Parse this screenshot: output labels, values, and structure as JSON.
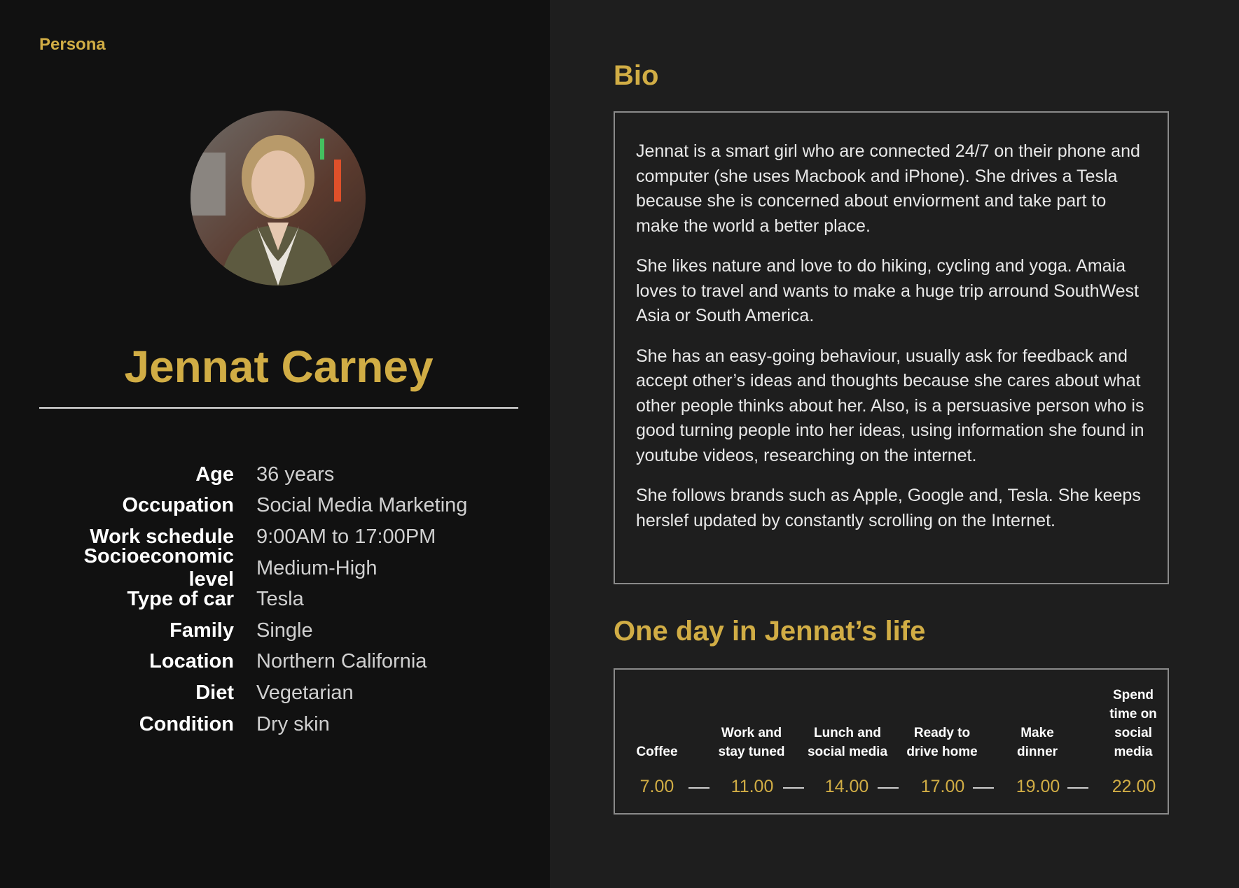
{
  "tag": "Persona",
  "name": "Jennat Carney",
  "details": [
    {
      "label": "Age",
      "value": "36 years"
    },
    {
      "label": "Occupation",
      "value": "Social Media Marketing"
    },
    {
      "label": "Work schedule",
      "value": "9:00AM to 17:00PM"
    },
    {
      "label": "Socioeconomic level",
      "value": "Medium-High"
    },
    {
      "label": "Type of car",
      "value": "Tesla"
    },
    {
      "label": "Family",
      "value": "Single"
    },
    {
      "label": "Location",
      "value": "Northern California"
    },
    {
      "label": "Diet",
      "value": "Vegetarian"
    },
    {
      "label": "Condition",
      "value": "Dry skin"
    }
  ],
  "bio": {
    "title": "Bio",
    "paragraphs": [
      "Jennat is a smart girl who are connected 24/7 on their phone and computer (she uses Macbook and iPhone). She drives a Tesla because she is concerned about enviorment and take part to make the world a better place.",
      "She likes nature and love to do hiking, cycling and yoga. Amaia loves to travel and wants to make a huge trip arround SouthWest Asia or South America.",
      "She has an easy-going behaviour, usually ask for feedback and accept other’s ideas and thoughts because she cares about what other people thinks about her. Also, is a persuasive person who is good turning people into her ideas, using information she found in youtube videos, researching on the internet.",
      "She follows brands such as Apple, Google and, Tesla. She keeps herslef updated by constantly scrolling on the Internet."
    ]
  },
  "day": {
    "title": "One day in Jennat’s life",
    "events": [
      {
        "label": "Coffee",
        "time": "7.00"
      },
      {
        "label": "Work and stay tuned",
        "time": "11.00"
      },
      {
        "label": "Lunch and social media",
        "time": "14.00"
      },
      {
        "label": "Ready to drive home",
        "time": "17.00"
      },
      {
        "label": "Make dinner",
        "time": "19.00"
      },
      {
        "label": "Spend time on social media",
        "time": "22.00"
      }
    ]
  },
  "colors": {
    "accent": "#d1ad45",
    "left_bg": "#111111",
    "right_bg": "#1e1e1e"
  }
}
